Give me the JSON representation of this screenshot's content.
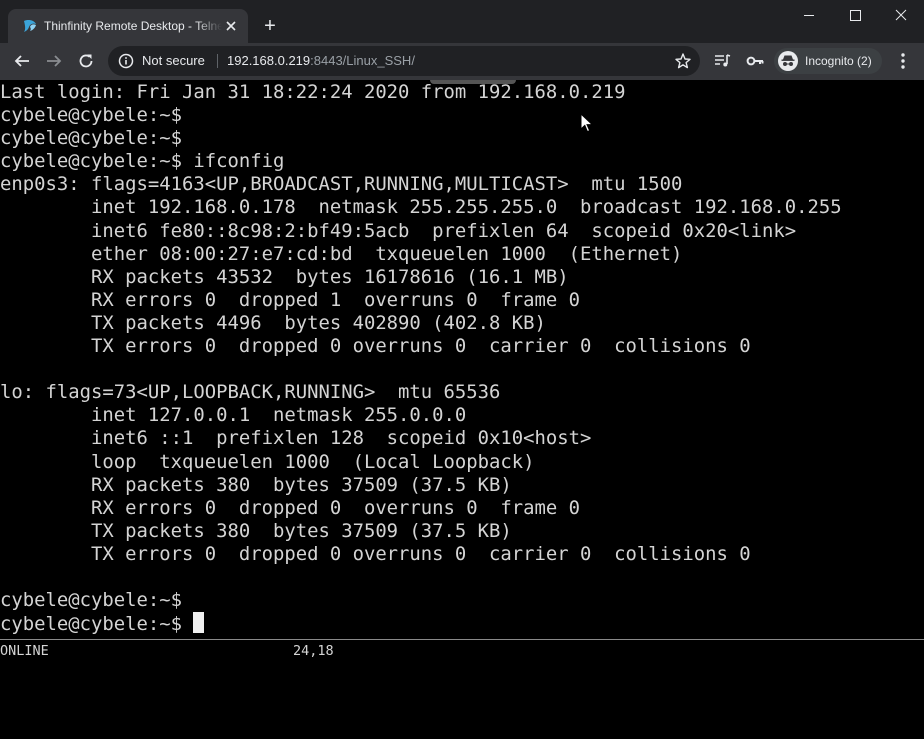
{
  "browser": {
    "tab_title": "Thinfinity Remote Desktop - Telnet",
    "new_tab_label": "+",
    "security_label": "Not secure",
    "url_host": "192.168.0.219",
    "url_rest": ":8443/Linux_SSH/",
    "incognito_label": "Incognito (2)"
  },
  "icons": {
    "favicon": "thinfinity-logo-icon",
    "tab_close": "close-icon",
    "back": "arrow-left-icon",
    "forward": "arrow-right-icon",
    "reload": "reload-icon",
    "info": "info-icon",
    "bookmark": "star-icon",
    "media": "media-control-icon",
    "passwords": "key-icon",
    "incognito": "incognito-icon",
    "menu": "kebab-menu-icon"
  },
  "terminal": {
    "lines": [
      "Last login: Fri Jan 31 18:22:24 2020 from 192.168.0.219",
      "cybele@cybele:~$",
      "cybele@cybele:~$",
      "cybele@cybele:~$ ifconfig",
      "enp0s3: flags=4163<UP,BROADCAST,RUNNING,MULTICAST>  mtu 1500",
      "        inet 192.168.0.178  netmask 255.255.255.0  broadcast 192.168.0.255",
      "        inet6 fe80::8c98:2:bf49:5acb  prefixlen 64  scopeid 0x20<link>",
      "        ether 08:00:27:e7:cd:bd  txqueuelen 1000  (Ethernet)",
      "        RX packets 43532  bytes 16178616 (16.1 MB)",
      "        RX errors 0  dropped 1  overruns 0  frame 0",
      "        TX packets 4496  bytes 402890 (402.8 KB)",
      "        TX errors 0  dropped 0 overruns 0  carrier 0  collisions 0",
      "",
      "lo: flags=73<UP,LOOPBACK,RUNNING>  mtu 65536",
      "        inet 127.0.0.1  netmask 255.0.0.0",
      "        inet6 ::1  prefixlen 128  scopeid 0x10<host>",
      "        loop  txqueuelen 1000  (Local Loopback)",
      "        RX packets 380  bytes 37509 (37.5 KB)",
      "        RX errors 0  dropped 0  overruns 0  frame 0",
      "        TX packets 380  bytes 37509 (37.5 KB)",
      "        TX errors 0  dropped 0 overruns 0  carrier 0  collisions 0",
      "",
      "cybele@cybele:~$"
    ],
    "prompt": "cybele@cybele:~$ ",
    "status_left": "ONLINE",
    "status_position": "24,18"
  },
  "colors": {
    "chrome_dark": "#202124",
    "chrome_toolbar": "#35363a",
    "terminal_bg": "#000000",
    "terminal_fg": "#d4d4d4"
  }
}
